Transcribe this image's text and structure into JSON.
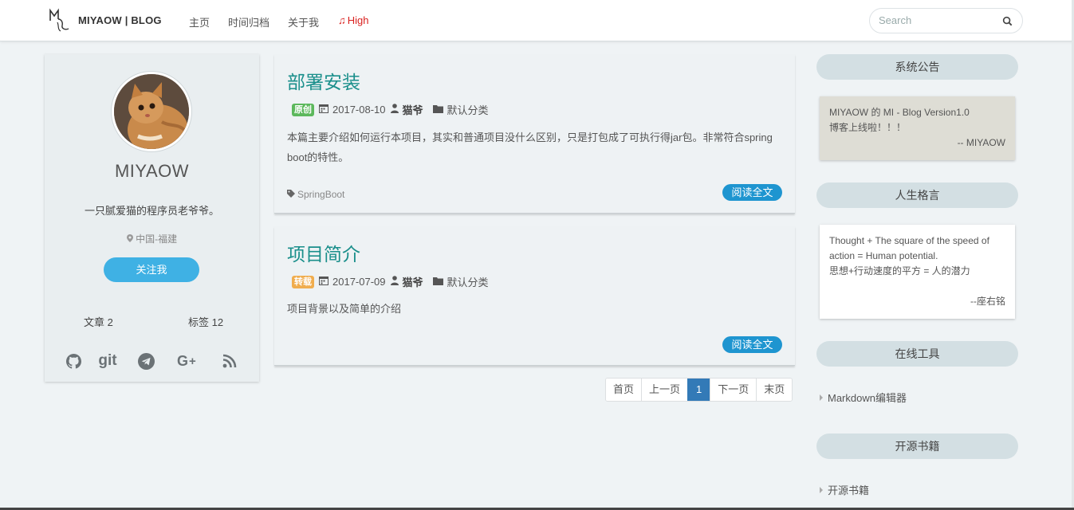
{
  "nav": {
    "brand": "MIYAOW | BLOG",
    "items": [
      "主页",
      "时间归档",
      "关于我"
    ],
    "high": "High",
    "search_placeholder": "Search"
  },
  "profile": {
    "name": "MIYAOW",
    "bio": "一只腻爱猫的程序员老爷爷。",
    "location": "中国-福建",
    "follow": "关注我",
    "articles": "文章 2",
    "tags": "标签 12",
    "git_text": "git"
  },
  "posts": [
    {
      "title": "部署安装",
      "badge": "原创",
      "date": "2017-08-10",
      "author": "猫爷",
      "category": "默认分类",
      "summary": "本篇主要介绍如何运行本项目，其实和普通项目没什么区别，只是打包成了可执行得jar包。非常符合spring boot的特性。",
      "tag": "SpringBoot",
      "read": "阅读全文"
    },
    {
      "title": "项目简介",
      "badge": "转载",
      "date": "2017-07-09",
      "author": "猫爷",
      "category": "默认分类",
      "summary": "项目背景以及简单的介绍",
      "read": "阅读全文"
    }
  ],
  "pagination": [
    "首页",
    "上一页",
    "1",
    "下一页",
    "末页"
  ],
  "sidebar": {
    "notice_title": "系统公告",
    "notice_line1": "MIYAOW 的 MI - Blog Version1.0",
    "notice_line2": "博客上线啦！！！",
    "notice_sign": "-- MIYAOW",
    "motto_title": "人生格言",
    "motto_line1": "Thought + The square of the speed of action = Human potential.",
    "motto_line2": "思想+行动速度的平方 = 人的潜力",
    "motto_sign": "--座右铭",
    "tools_title": "在线工具",
    "tools_link": "Markdown编辑器",
    "books_title": "开源书籍",
    "books_link": "开源书籍"
  },
  "colors": {
    "accent": "#1a8f8b",
    "button": "#3fb1e4",
    "read_button": "#1e95d0",
    "active_page": "#337ab7",
    "notice_bg": "#deddd5"
  }
}
